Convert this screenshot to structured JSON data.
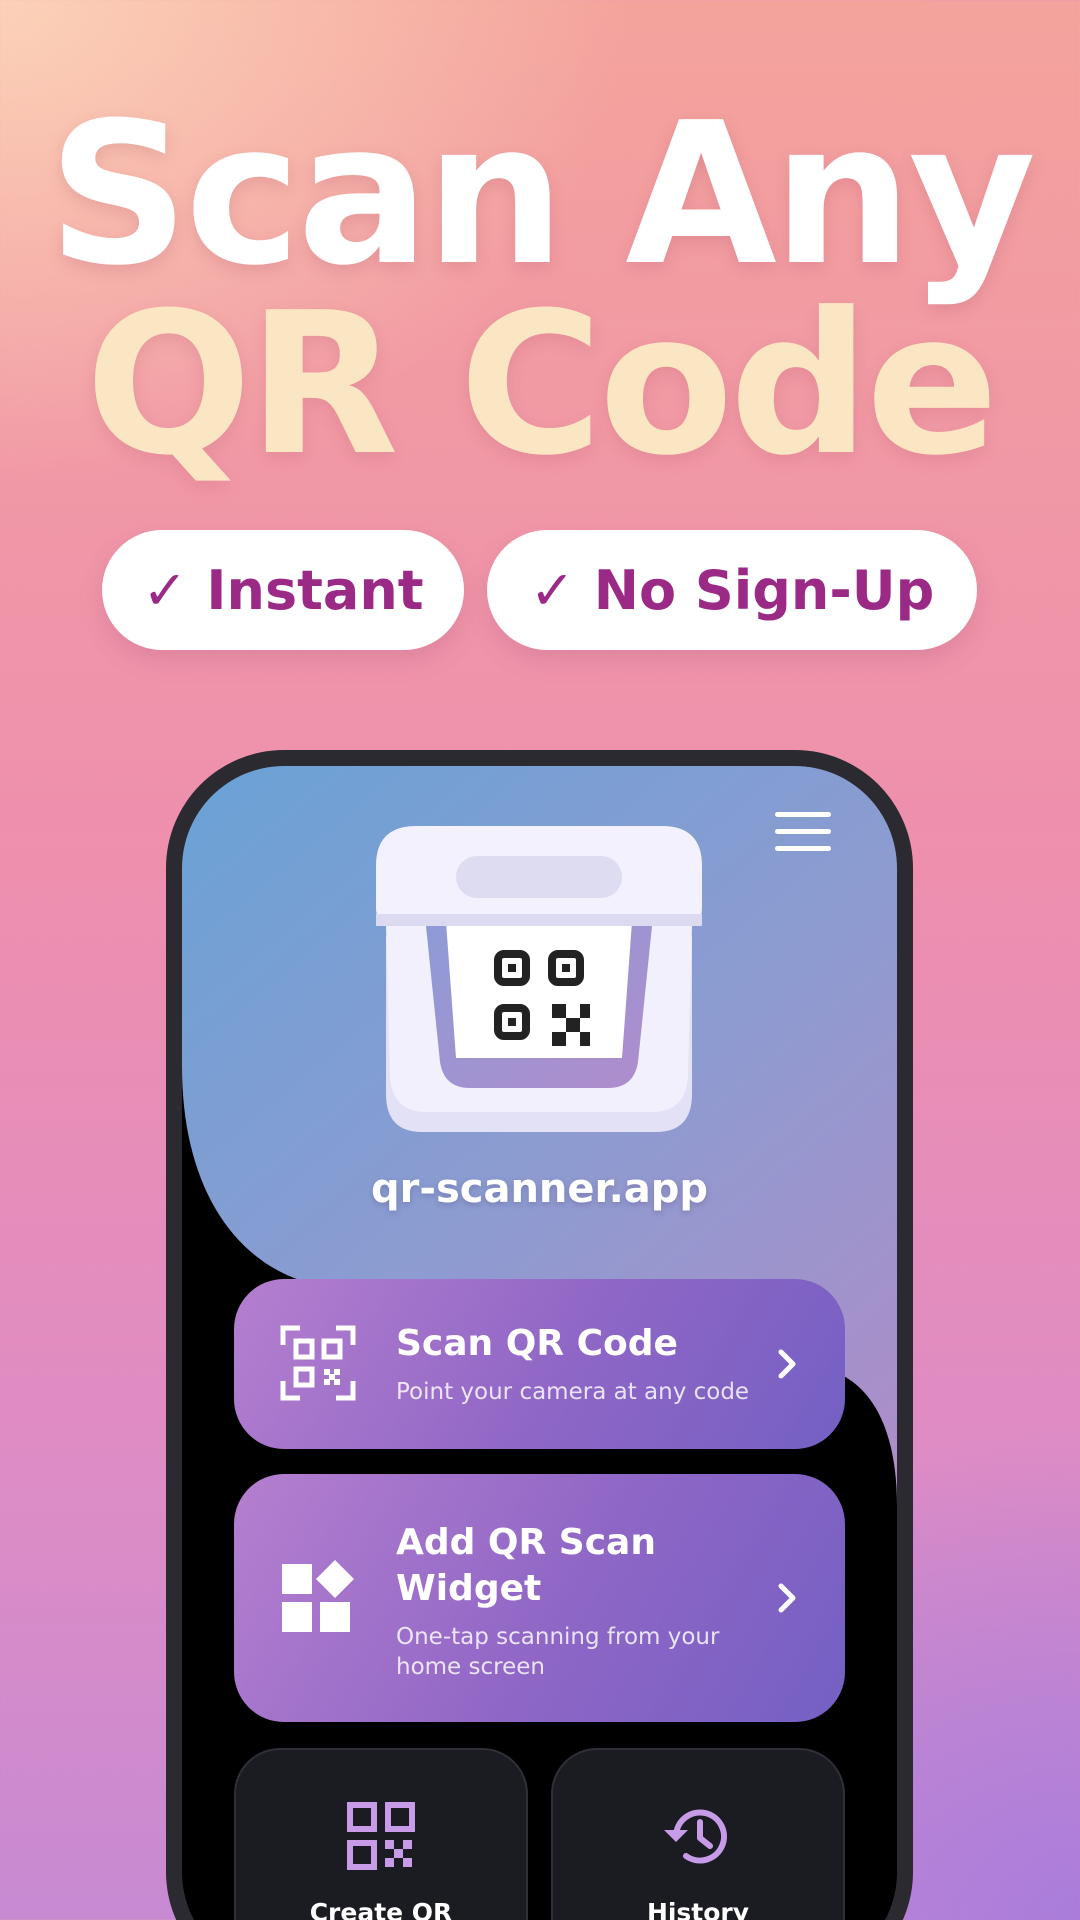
{
  "headline": {
    "line1": "Scan Any",
    "line2": "QR Code"
  },
  "badges": [
    {
      "label": "✓ Instant"
    },
    {
      "label": "✓ No Sign-Up"
    }
  ],
  "app": {
    "domain": "qr-scanner.app",
    "menu_icon": "hamburger-menu-icon",
    "hero_icon": "qr-scanner-printer-icon"
  },
  "cards": [
    {
      "title": "Scan QR Code",
      "subtitle": "Point your camera at any code",
      "icon": "qr-scan-icon"
    },
    {
      "title": "Add QR Scan Widget",
      "subtitle": "One-tap scanning from your home screen",
      "icon": "widget-icon"
    }
  ],
  "tiles": [
    {
      "label": "Create QR",
      "icon": "qr-code-icon"
    },
    {
      "label": "History",
      "icon": "history-icon"
    }
  ],
  "colors": {
    "headline_accent": "#fbe6c4",
    "badge_text": "#9a2a86",
    "card_gradient_start": "#b57fcf",
    "card_gradient_end": "#7460c3",
    "tile_icon": "#c79be8"
  }
}
